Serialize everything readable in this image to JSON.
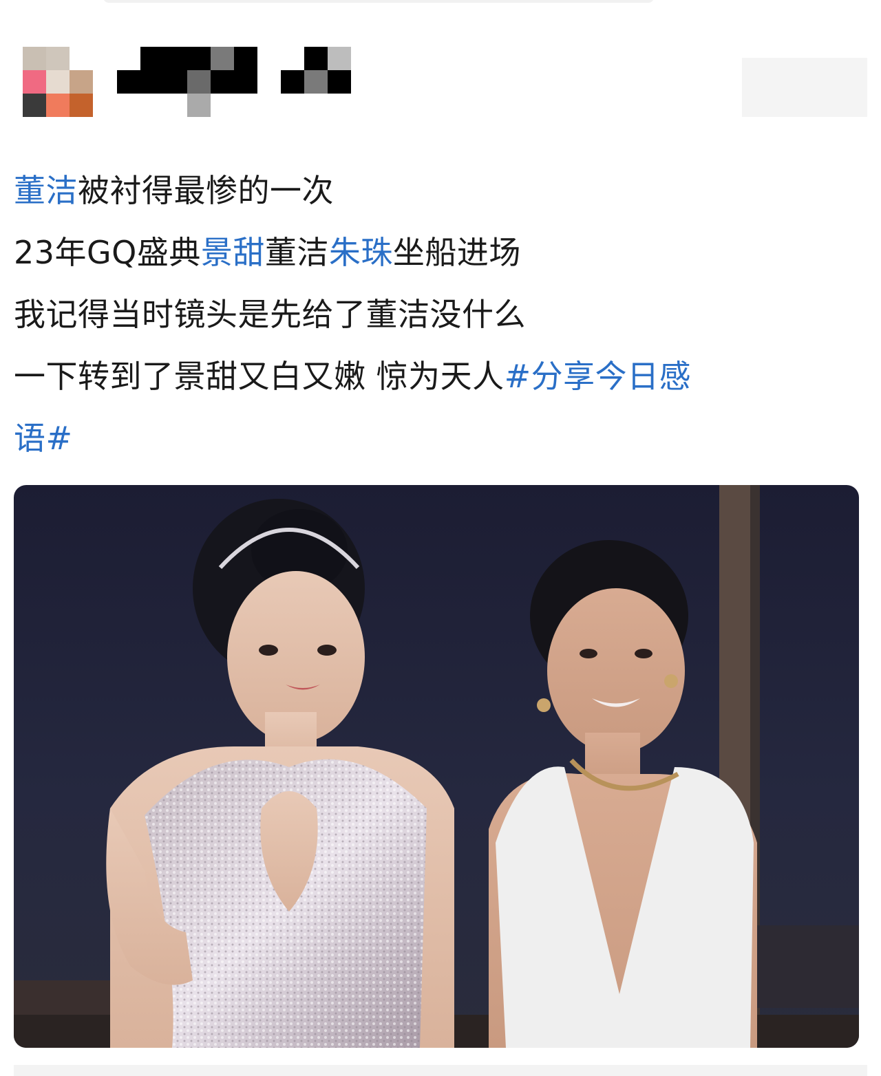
{
  "header": {
    "avatar_icon": "blurred-avatar",
    "username": "",
    "follow_button": ""
  },
  "post": {
    "lines": [
      [
        {
          "text": "董洁",
          "link": true
        },
        {
          "text": "被衬得最惨的一次",
          "link": false
        }
      ],
      [
        {
          "text": "23年GQ盛典",
          "link": false
        },
        {
          "text": "景甜",
          "link": true
        },
        {
          "text": "董洁",
          "link": false
        },
        {
          "text": "朱珠",
          "link": true
        },
        {
          "text": "坐船进场",
          "link": false
        }
      ],
      [
        {
          "text": "我记得当时镜头是先给了董洁没什么",
          "link": false
        }
      ],
      [
        {
          "text": "一下转到了景甜又白又嫩 惊为天人",
          "link": false
        },
        {
          "text": "#分享今日感",
          "link": true
        }
      ],
      [
        {
          "text": "语#",
          "link": true
        }
      ]
    ]
  },
  "image": {
    "subject": "two-women-at-event-photo"
  },
  "colors": {
    "link": "#2a6fc7",
    "text": "#1a1a1a",
    "background": "#ffffff"
  }
}
